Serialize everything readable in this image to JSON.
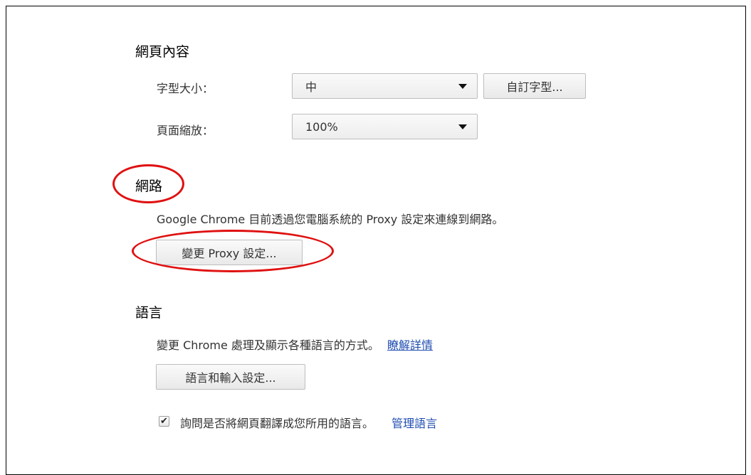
{
  "page_content": {
    "title": "網頁內容",
    "font_size_label": "字型大小：",
    "font_size_value": "中",
    "custom_fonts_button": "自訂字型...",
    "zoom_label": "頁面縮放：",
    "zoom_value": "100%"
  },
  "network": {
    "title": "網路",
    "description": "Google Chrome 目前透過您電腦系統的 Proxy 設定來連線到網路。",
    "proxy_button": "變更 Proxy 設定..."
  },
  "languages": {
    "title": "語言",
    "description": "變更 Chrome 處理及顯示各種語言的方式。",
    "learn_more_link": "瞭解詳情",
    "language_input_button": "語言和輸入設定...",
    "translate_checkbox_label": "詢問是否將網頁翻譯成您所用的語言。",
    "translate_checked": true,
    "manage_languages_link": "管理語言"
  },
  "annotation_color": "#e01010",
  "link_color": "#1f4db0"
}
